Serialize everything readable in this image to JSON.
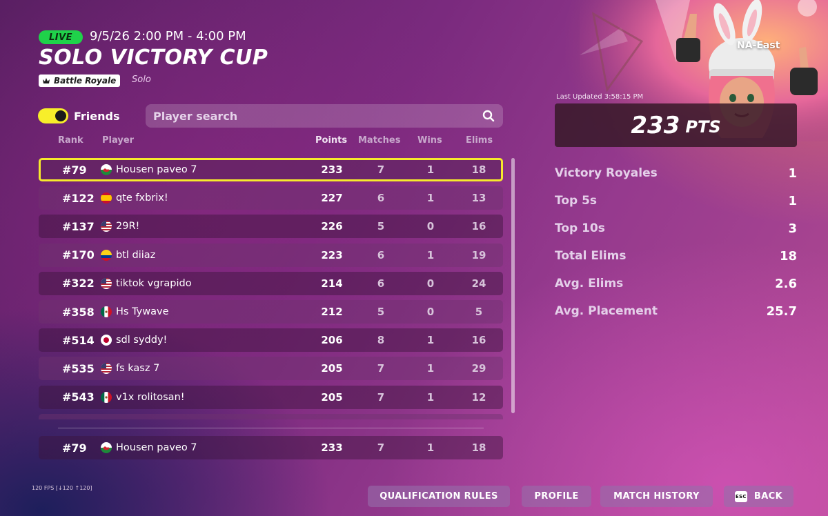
{
  "header": {
    "live_label": "LIVE",
    "time": "9/5/26 2:00 PM - 4:00 PM",
    "title": "SOLO VICTORY CUP",
    "mode": "Battle Royale",
    "mode_sub": "Solo"
  },
  "filters": {
    "friends_label": "Friends",
    "friends_on": true,
    "search_placeholder": "Player search"
  },
  "columns": {
    "rank": "Rank",
    "player": "Player",
    "points": "Points",
    "matches": "Matches",
    "wins": "Wins",
    "elims": "Elims"
  },
  "rows": [
    {
      "rank": "#79",
      "flag": "wales",
      "name": "Housen paveo 7",
      "points": "233",
      "matches": "7",
      "wins": "1",
      "elims": "18"
    },
    {
      "rank": "#122",
      "flag": "spain",
      "name": "qte fxbrix!",
      "points": "227",
      "matches": "6",
      "wins": "1",
      "elims": "13"
    },
    {
      "rank": "#137",
      "flag": "usa",
      "name": "29R!",
      "points": "226",
      "matches": "5",
      "wins": "0",
      "elims": "16"
    },
    {
      "rank": "#170",
      "flag": "colombia",
      "name": "btl diiaz",
      "points": "223",
      "matches": "6",
      "wins": "1",
      "elims": "19"
    },
    {
      "rank": "#322",
      "flag": "usa",
      "name": "tiktok vgrapido",
      "points": "214",
      "matches": "6",
      "wins": "0",
      "elims": "24"
    },
    {
      "rank": "#358",
      "flag": "mexico",
      "name": "Hs Tywave",
      "points": "212",
      "matches": "5",
      "wins": "0",
      "elims": "5"
    },
    {
      "rank": "#514",
      "flag": "japan",
      "name": "sdl syddy!",
      "points": "206",
      "matches": "8",
      "wins": "1",
      "elims": "16"
    },
    {
      "rank": "#535",
      "flag": "usa",
      "name": "fs kasz 7",
      "points": "205",
      "matches": "7",
      "wins": "1",
      "elims": "29"
    },
    {
      "rank": "#543",
      "flag": "mexico",
      "name": "v1x rolitosan!",
      "points": "205",
      "matches": "7",
      "wins": "1",
      "elims": "12"
    }
  ],
  "self_row": {
    "rank": "#79",
    "flag": "wales",
    "name": "Housen paveo 7",
    "points": "233",
    "matches": "7",
    "wins": "1",
    "elims": "18"
  },
  "summary": {
    "region": "NA-East",
    "last_updated": "Last Updated 3:58:15 PM",
    "points": "233",
    "points_unit": "PTS",
    "stats": [
      {
        "label": "Victory Royales",
        "value": "1"
      },
      {
        "label": "Top 5s",
        "value": "1"
      },
      {
        "label": "Top 10s",
        "value": "3"
      },
      {
        "label": "Total Elims",
        "value": "18"
      },
      {
        "label": "Avg. Elims",
        "value": "2.6"
      },
      {
        "label": "Avg. Placement",
        "value": "25.7"
      }
    ]
  },
  "footer": {
    "fps": "120 FPS [↓120 ↑120]",
    "qualification_rules": "QUALIFICATION RULES",
    "profile": "PROFILE",
    "match_history": "MATCH HISTORY",
    "esc_key": "ESC",
    "back": "BACK"
  },
  "colors": {
    "live": "#1fd24a",
    "accent_yellow": "#f6ea2c"
  },
  "icons": {
    "search": "search-icon",
    "mode": "crown-icon",
    "esc": "esc-key-icon"
  }
}
